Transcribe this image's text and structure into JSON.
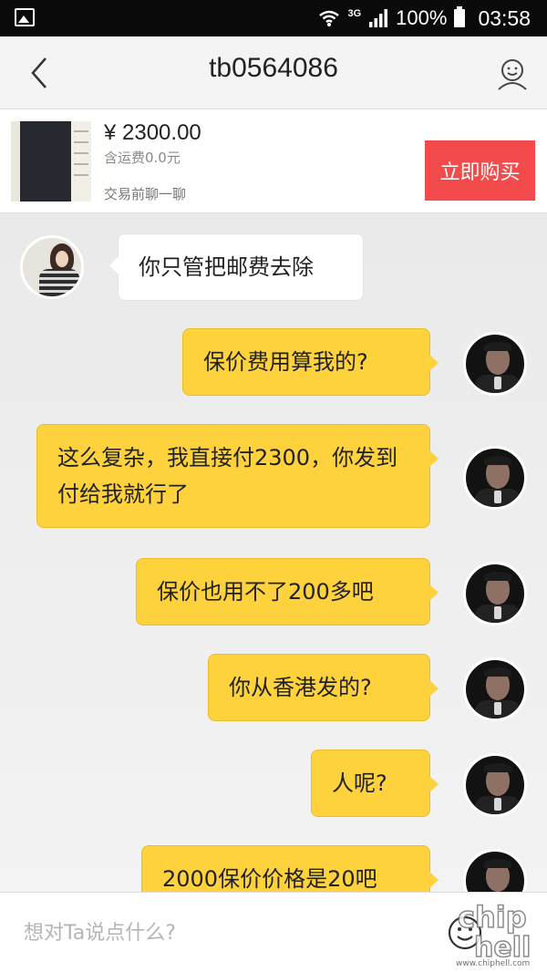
{
  "status_bar": {
    "network": "3G",
    "battery_percent": "100%",
    "time": "03:58",
    "icons": [
      "gallery-icon",
      "wifi-icon",
      "signal-icon",
      "battery-icon"
    ]
  },
  "nav": {
    "title": "tb0564086",
    "icons": [
      "back-icon",
      "profile-icon"
    ]
  },
  "product": {
    "price": "¥ 2300.00",
    "shipping": "含运费0.0元",
    "chat_hint": "交易前聊一聊",
    "buy_label": "立即购买"
  },
  "messages": [
    {
      "from": "other",
      "text": "你只管把邮费去除"
    },
    {
      "from": "self",
      "text": "保价费用算我的?"
    },
    {
      "from": "self",
      "text": "这么复杂，我直接付2300，你发到付给我就行了"
    },
    {
      "from": "self",
      "text": "保价也用不了200多吧"
    },
    {
      "from": "self",
      "text": "你从香港发的?"
    },
    {
      "from": "self",
      "text": "人呢?"
    },
    {
      "from": "self",
      "text": "2000保价价格是20吧"
    }
  ],
  "input": {
    "placeholder": "想对Ta说点什么?",
    "value": ""
  },
  "watermark": {
    "text": "www.chiphell.com"
  },
  "colors": {
    "accent_yellow": "#fdd23c",
    "buy_red": "#f34b4b",
    "status_bar": "#0a0a0a"
  }
}
